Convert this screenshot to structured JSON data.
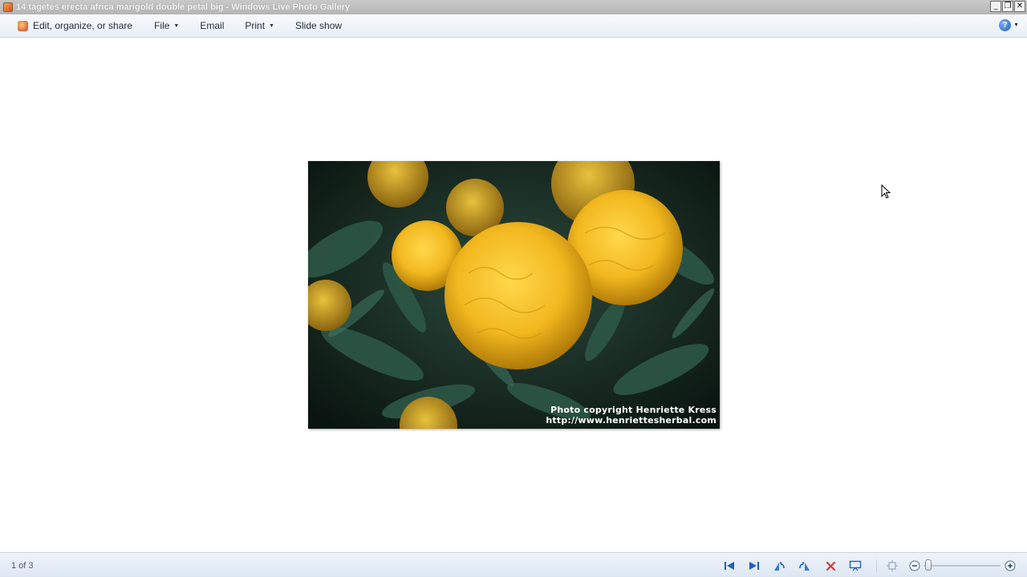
{
  "window": {
    "title": "14 tagetes erecta africa marigold double petal big - Windows Live Photo Gallery",
    "controls": {
      "minimize": "_",
      "restore": "❐",
      "close": "✕"
    }
  },
  "menu": {
    "edit_label": "Edit, organize, or share",
    "file_label": "File",
    "email_label": "Email",
    "print_label": "Print",
    "slideshow_label": "Slide show",
    "help_glyph": "?"
  },
  "photo": {
    "copyright_line1": "Photo copyright Henriette Kress",
    "copyright_line2": "http://www.henriettesherbal.com"
  },
  "status": {
    "counter": "1 of 3"
  },
  "icons": {
    "previous": "previous-icon",
    "next": "next-icon",
    "rotate_left": "rotate-left-icon",
    "rotate_right": "rotate-right-icon",
    "delete": "delete-icon",
    "slideshow": "slideshow-icon",
    "actual_size": "actual-size-icon",
    "zoom_out": "zoom-out-icon",
    "zoom_in": "zoom-in-icon"
  },
  "colors": {
    "accent_blue": "#1f5fbf",
    "delete_red": "#d63a3a",
    "marigold": "#f2b820"
  }
}
